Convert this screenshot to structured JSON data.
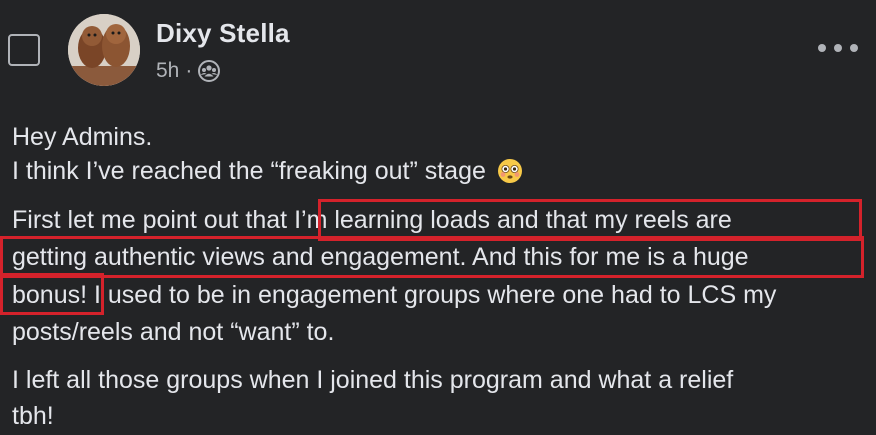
{
  "post": {
    "author": "Dixy Stella",
    "time": "5h",
    "separator": "·",
    "audience_icon": "group-icon",
    "lines": {
      "l1": "Hey Admins.",
      "l2": "I think I’ve reached the “freaking out” stage",
      "l3": "First let me point out that I’m learning loads and that my reels are",
      "l4": "getting authentic views and engagement. And this for me is a huge",
      "l5": "bonus! I used to be in engagement groups where one had to LCS my",
      "l6": "posts/reels and not “want” to.",
      "l7": "I left all those groups when I joined this program and what a relief",
      "l8": "tbh!"
    },
    "emoji": "flushed-face-emoji"
  },
  "colors": {
    "background": "#232426",
    "text": "#e4e6eb",
    "secondary": "#b0b3b8",
    "highlight": "#d4222b"
  }
}
